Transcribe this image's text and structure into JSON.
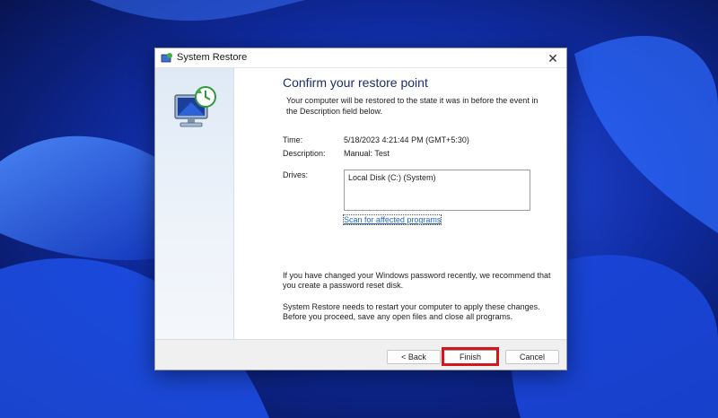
{
  "window": {
    "title": "System Restore",
    "close_glyph": "✕"
  },
  "icons": {
    "title": "system-restore-icon",
    "hero": "monitor-restore-icon"
  },
  "heading": "Confirm your restore point",
  "intro": "Your computer will be restored to the state it was in before the event in the Description field below.",
  "fields": {
    "time_label": "Time:",
    "time_value": "5/18/2023 4:21:44 PM (GMT+5:30)",
    "description_label": "Description:",
    "description_value": "Manual: Test",
    "drives_label": "Drives:",
    "drives": [
      "Local Disk (C:) (System)"
    ]
  },
  "scan_link": "Scan for affected programs",
  "notes": {
    "password": "If you have changed your Windows password recently, we recommend that you create a password reset disk.",
    "restart": "System Restore needs to restart your computer to apply these changes. Before you proceed, save any open files and close all programs."
  },
  "buttons": {
    "back": "< Back",
    "finish": "Finish",
    "cancel": "Cancel"
  },
  "colors": {
    "highlight": "#d4151c",
    "link": "#2a66c4",
    "wallpaper": "#1a3fd0"
  }
}
